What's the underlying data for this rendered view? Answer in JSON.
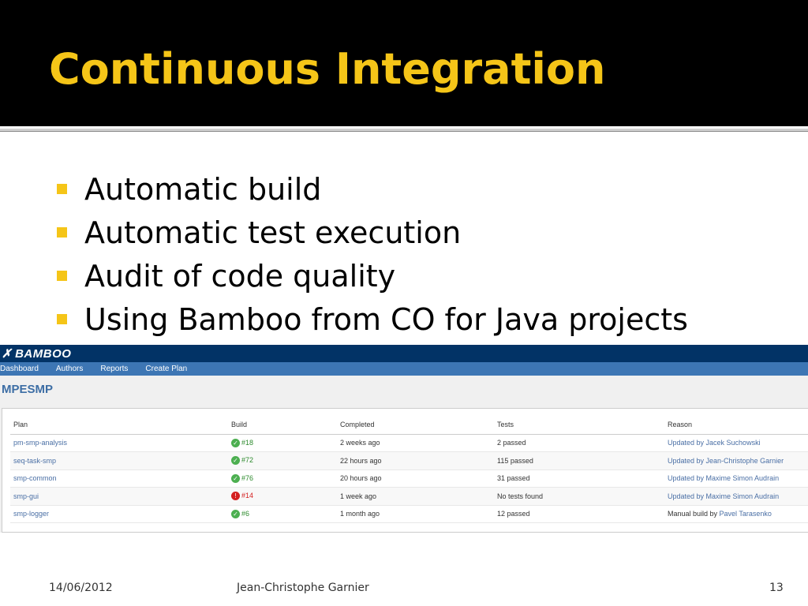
{
  "slide": {
    "title": "Continuous Integration",
    "bullets": [
      "Automatic build",
      "Automatic test execution",
      "Audit of code quality",
      "Using Bamboo from CO for Java projects"
    ],
    "footer": {
      "date": "14/06/2012",
      "author": "Jean-Christophe Garnier",
      "page": "13"
    }
  },
  "bamboo": {
    "logo": "BAMBOO",
    "nav": [
      "Dashboard",
      "Authors",
      "Reports",
      "Create Plan"
    ],
    "project": "MPESMP",
    "columns": [
      "Plan",
      "Build",
      "Completed",
      "Tests",
      "Reason"
    ],
    "rows": [
      {
        "plan": "pm-smp-analysis",
        "status": "success",
        "build": "#18",
        "completed": "2 weeks ago",
        "tests": "2 passed",
        "reason_prefix": "",
        "reason_link": "Updated by Jacek Suchowski"
      },
      {
        "plan": "seq-task-smp",
        "status": "success",
        "build": "#72",
        "completed": "22 hours ago",
        "tests": "115 passed",
        "reason_prefix": "",
        "reason_link": "Updated by Jean-Christophe Garnier"
      },
      {
        "plan": "smp-common",
        "status": "success",
        "build": "#76",
        "completed": "20 hours ago",
        "tests": "31 passed",
        "reason_prefix": "",
        "reason_link": "Updated by Maxime Simon Audrain"
      },
      {
        "plan": "smp-gui",
        "status": "failed",
        "build": "#14",
        "completed": "1 week ago",
        "tests": "No tests found",
        "reason_prefix": "",
        "reason_link": "Updated by Maxime Simon Audrain"
      },
      {
        "plan": "smp-logger",
        "status": "success",
        "build": "#6",
        "completed": "1 month ago",
        "tests": "12 passed",
        "reason_prefix": "Manual build by ",
        "reason_link": "Pavel Tarasenko"
      }
    ]
  },
  "colors": {
    "title": "#f5c518",
    "header": "#023366",
    "nav": "#3d76b4",
    "success": "#2e8b2e",
    "failed": "#d42020"
  }
}
